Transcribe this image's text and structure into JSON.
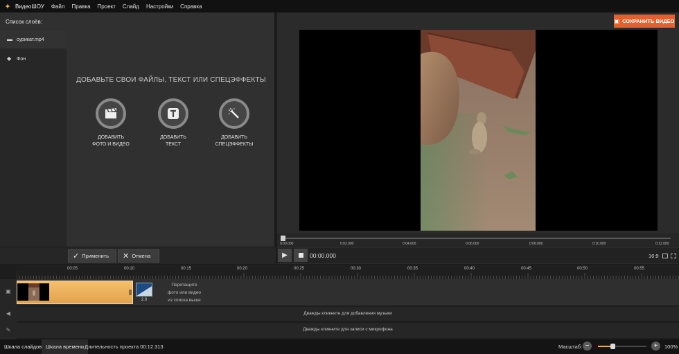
{
  "app": {
    "name": "ВидеоШОУ"
  },
  "menu": [
    "Файл",
    "Правка",
    "Проект",
    "Слайд",
    "Настройки",
    "Справка"
  ],
  "left_panel": {
    "title": "Список слоёв:",
    "items": [
      {
        "label": "сурикат.mp4",
        "icon": "film-icon"
      },
      {
        "label": "Фон",
        "icon": "fill-icon"
      }
    ],
    "add_hint": "ДОБАВЬТЕ СВОИ ФАЙЛЫ, ТЕКСТ ИЛИ СПЕЦЭФФЕКТЫ",
    "add_buttons": [
      {
        "label": "ДОБАВИТЬ\nФОТО И ВИДЕО",
        "icon": "clapperboard-icon"
      },
      {
        "label": "ДОБАВИТЬ\nТЕКСТ",
        "icon": "text-icon"
      },
      {
        "label": "ДОБАВИТЬ\nСПЕЦЭФФЕКТЫ",
        "icon": "magic-wand-icon"
      }
    ],
    "apply_label": "Применить",
    "cancel_label": "Отмена"
  },
  "preview": {
    "save_label": "СОХРАНИТЬ ВИДЕО",
    "ruler_ticks": [
      "0:00.000",
      "0:02.000",
      "0:04.000",
      "0:06.000",
      "0:08.000",
      "0:10.000",
      "0:12.000"
    ],
    "time": "00:00.000",
    "aspect": "16:9"
  },
  "timeline": {
    "ticks": [
      "00:05",
      "00:10",
      "00:15",
      "00:20",
      "00:25",
      "00:30",
      "00:35",
      "00:40",
      "00:45",
      "00:50",
      "00:55"
    ],
    "transition_value": "2.0",
    "drop_hint": "Перетащите\nфото или видео\nиз списка выше",
    "music_hint": "Дважды кликните для добавления музыки",
    "mic_hint": "Дважды кликните для записи с микрофона"
  },
  "status": {
    "tab_slides": "Шкала слайдов",
    "tab_timeline": "Шкала времени",
    "duration": "Длительность проекта 00:12.313",
    "zoom_label": "Масштаб:",
    "zoom_value": "100%",
    "zoom_level": 0.3
  },
  "colors": {
    "accent": "#e5602d",
    "clip": "#f2b45f",
    "zoom_fill": "#e9b14a"
  }
}
